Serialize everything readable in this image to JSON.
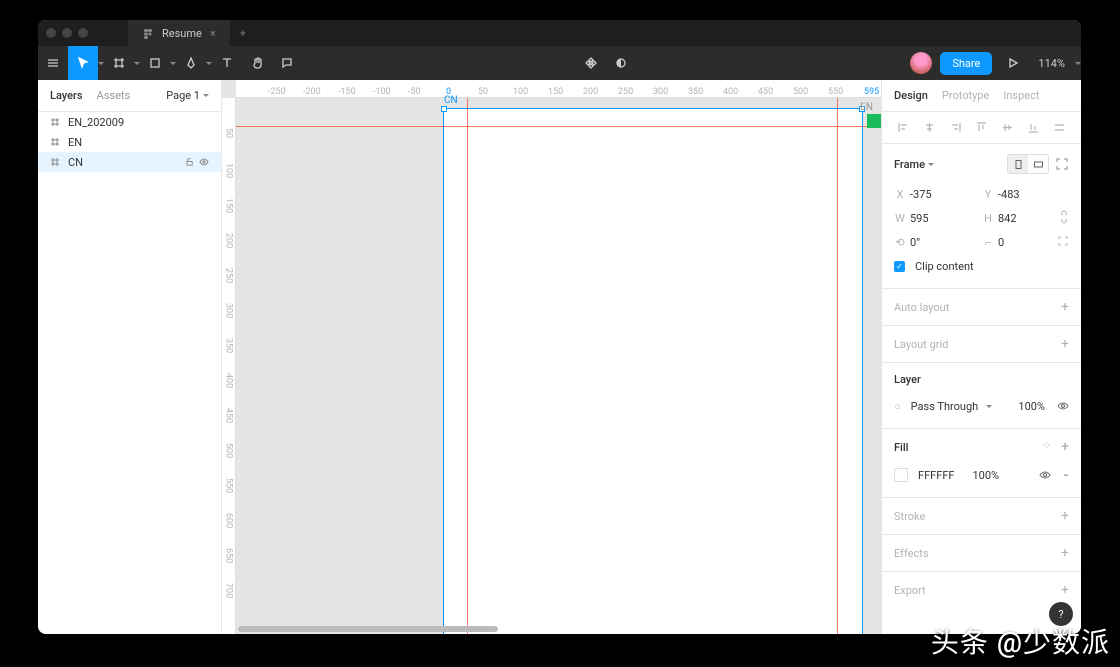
{
  "tab": {
    "title": "Resume"
  },
  "toolbar": {
    "share": "Share",
    "zoom": "114%"
  },
  "leftPanel": {
    "tabs": {
      "layers": "Layers",
      "assets": "Assets"
    },
    "page": "Page 1",
    "items": [
      "EN_202009",
      "EN",
      "CN"
    ]
  },
  "ruler": {
    "h": [
      "-250",
      "-200",
      "-150",
      "-100",
      "-50",
      "0",
      "50",
      "100",
      "150",
      "200",
      "250",
      "300",
      "350",
      "400",
      "450",
      "500",
      "550"
    ],
    "hHighlight": [
      "0",
      "595"
    ],
    "v": [
      "50",
      "100",
      "150",
      "200",
      "250",
      "300",
      "350",
      "400",
      "450",
      "500",
      "550",
      "600",
      "650",
      "700"
    ]
  },
  "frame": {
    "label": "CN",
    "enLabel": "EN"
  },
  "design": {
    "tabs": {
      "design": "Design",
      "prototype": "Prototype",
      "inspect": "Inspect"
    },
    "frameSection": "Frame",
    "x": "-375",
    "y": "-483",
    "w": "595",
    "h": "842",
    "rotation": "0°",
    "corner": "0",
    "clip": "Clip content",
    "autolayout": "Auto layout",
    "layoutgrid": "Layout grid",
    "layerSection": "Layer",
    "blend": "Pass Through",
    "opacity": "100%",
    "fillSection": "Fill",
    "fillHex": "FFFFFF",
    "fillOpacity": "100%",
    "stroke": "Stroke",
    "effects": "Effects",
    "export": "Export"
  },
  "watermark": "头条 @少数派"
}
